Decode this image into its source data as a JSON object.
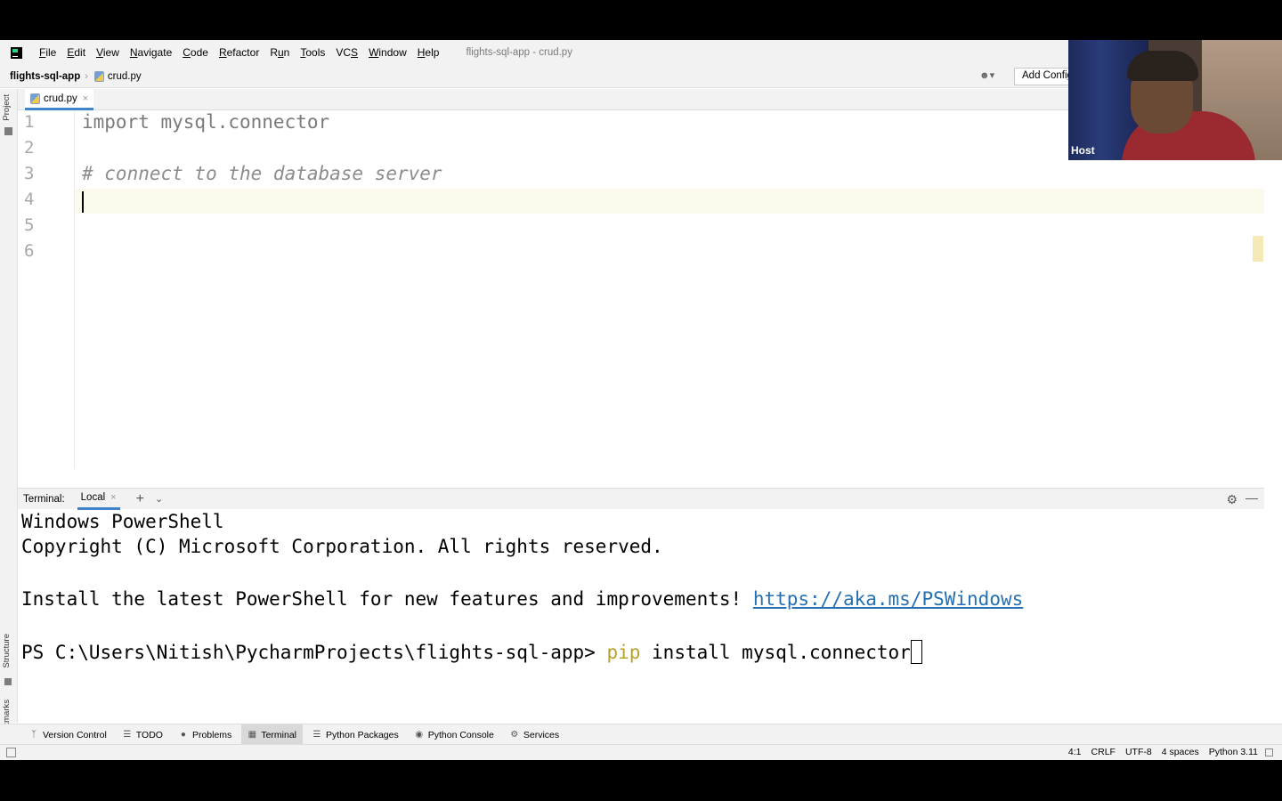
{
  "app": {
    "window_title": "flights-sql-app - crud.py"
  },
  "menu": [
    {
      "label_pre": "",
      "mnemonic": "F",
      "label_post": "ile"
    },
    {
      "label_pre": "",
      "mnemonic": "E",
      "label_post": "dit"
    },
    {
      "label_pre": "",
      "mnemonic": "V",
      "label_post": "iew"
    },
    {
      "label_pre": "",
      "mnemonic": "N",
      "label_post": "avigate"
    },
    {
      "label_pre": "",
      "mnemonic": "C",
      "label_post": "ode"
    },
    {
      "label_pre": "",
      "mnemonic": "R",
      "label_post": "efactor"
    },
    {
      "label_pre": "R",
      "mnemonic": "u",
      "label_post": "n"
    },
    {
      "label_pre": "",
      "mnemonic": "T",
      "label_post": "ools"
    },
    {
      "label_pre": "VC",
      "mnemonic": "S",
      "label_post": ""
    },
    {
      "label_pre": "",
      "mnemonic": "W",
      "label_post": "indow"
    },
    {
      "label_pre": "",
      "mnemonic": "H",
      "label_post": "elp"
    }
  ],
  "navbar": {
    "project": "flights-sql-app",
    "file": "crud.py",
    "add_config": "Add Configuration..."
  },
  "left_stripe": {
    "project": "Project",
    "structure": "Structure",
    "bookmarks": "Bookmarks"
  },
  "editor": {
    "tab_label": "crud.py",
    "line_numbers": [
      "1",
      "2",
      "3",
      "4",
      "5",
      "6"
    ],
    "lines": {
      "l1": "import mysql.connector",
      "l3": "# connect to the database server"
    }
  },
  "terminal": {
    "title": "Terminal:",
    "tab": "Local",
    "line1": "Windows PowerShell",
    "line2": "Copyright (C) Microsoft Corporation. All rights reserved.",
    "line3_text": "Install the latest PowerShell for new features and improvements! ",
    "line3_link": "https://aka.ms/PSWindows",
    "prompt": "PS C:\\Users\\Nitish\\PycharmProjects\\flights-sql-app> ",
    "cmd_name": "pip",
    "cmd_args": " install mysql.connector"
  },
  "toolwindows": [
    {
      "label": "Version Control",
      "icon": "branch-icon",
      "active": false
    },
    {
      "label": "TODO",
      "icon": "list-icon",
      "active": false
    },
    {
      "label": "Problems",
      "icon": "problems-icon",
      "active": false
    },
    {
      "label": "Terminal",
      "icon": "terminal-icon",
      "active": true
    },
    {
      "label": "Python Packages",
      "icon": "packages-icon",
      "active": false
    },
    {
      "label": "Python Console",
      "icon": "console-icon",
      "active": false
    },
    {
      "label": "Services",
      "icon": "services-icon",
      "active": false
    }
  ],
  "status": {
    "position": "4:1",
    "line_sep": "CRLF",
    "encoding": "UTF-8",
    "indent": "4 spaces",
    "interpreter": "Python 3.11"
  },
  "webcam": {
    "label": "Host"
  }
}
